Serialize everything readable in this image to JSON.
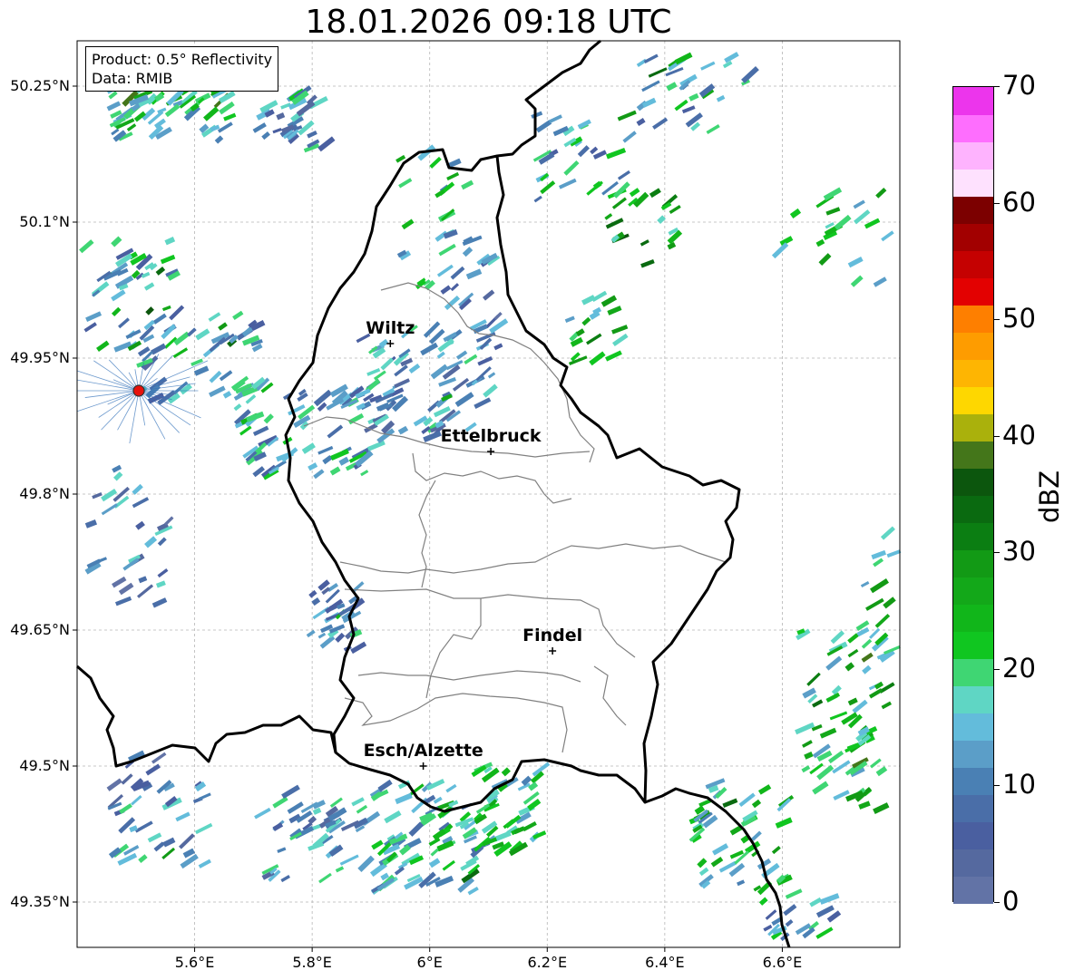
{
  "title": "18.01.2026 09:18 UTC",
  "info": {
    "product": "Product: 0.5° Reflectivity",
    "data": "Data: RMIB"
  },
  "map": {
    "lon_range": [
      5.4,
      6.8
    ],
    "lat_range": [
      49.3,
      50.3
    ],
    "lat_ticks": [
      {
        "value": 50.25,
        "label": "50.25°N"
      },
      {
        "value": 50.1,
        "label": "50.1°N"
      },
      {
        "value": 49.95,
        "label": "49.95°N"
      },
      {
        "value": 49.8,
        "label": "49.8°N"
      },
      {
        "value": 49.65,
        "label": "49.65°N"
      },
      {
        "value": 49.5,
        "label": "49.5°N"
      },
      {
        "value": 49.35,
        "label": "49.35°N"
      }
    ],
    "lon_ticks": [
      {
        "value": 5.6,
        "label": "5.6°E"
      },
      {
        "value": 5.8,
        "label": "5.8°E"
      },
      {
        "value": 6.0,
        "label": "6°E"
      },
      {
        "value": 6.2,
        "label": "6.2°E"
      },
      {
        "value": 6.4,
        "label": "6.4°E"
      },
      {
        "value": 6.6,
        "label": "6.6°E"
      }
    ],
    "grid": true,
    "radar_site": {
      "lon": 5.505,
      "lat": 49.914,
      "color": "#e8120c"
    },
    "cities": [
      {
        "name": "Wiltz",
        "lon": 5.933,
        "lat": 49.966
      },
      {
        "name": "Ettelbruck",
        "lon": 6.104,
        "lat": 49.847
      },
      {
        "name": "Findel",
        "lon": 6.209,
        "lat": 49.627
      },
      {
        "name": "Esch/Alzette",
        "lon": 5.989,
        "lat": 49.5
      }
    ],
    "echo_clusters": [
      {
        "lon": 5.55,
        "lat": 50.22,
        "rx": 0.1,
        "ry": 0.03,
        "n": 60,
        "level": 18
      },
      {
        "lon": 5.75,
        "lat": 50.21,
        "rx": 0.06,
        "ry": 0.03,
        "n": 30,
        "level": 12
      },
      {
        "lon": 5.48,
        "lat": 50.02,
        "rx": 0.08,
        "ry": 0.06,
        "n": 45,
        "level": 15
      },
      {
        "lon": 5.6,
        "lat": 49.95,
        "rx": 0.1,
        "ry": 0.05,
        "n": 50,
        "level": 12
      },
      {
        "lon": 5.78,
        "lat": 49.87,
        "rx": 0.12,
        "ry": 0.05,
        "n": 70,
        "level": 14
      },
      {
        "lon": 5.95,
        "lat": 49.92,
        "rx": 0.08,
        "ry": 0.06,
        "n": 60,
        "level": 12
      },
      {
        "lon": 6.06,
        "lat": 49.97,
        "rx": 0.05,
        "ry": 0.1,
        "n": 40,
        "level": 10
      },
      {
        "lon": 6.0,
        "lat": 50.1,
        "rx": 0.06,
        "ry": 0.08,
        "n": 25,
        "level": 18
      },
      {
        "lon": 6.25,
        "lat": 50.17,
        "rx": 0.08,
        "ry": 0.05,
        "n": 30,
        "level": 15
      },
      {
        "lon": 6.35,
        "lat": 50.09,
        "rx": 0.06,
        "ry": 0.05,
        "n": 20,
        "level": 25
      },
      {
        "lon": 6.28,
        "lat": 49.98,
        "rx": 0.05,
        "ry": 0.04,
        "n": 18,
        "level": 22
      },
      {
        "lon": 6.45,
        "lat": 50.24,
        "rx": 0.1,
        "ry": 0.04,
        "n": 30,
        "level": 14
      },
      {
        "lon": 6.68,
        "lat": 50.08,
        "rx": 0.1,
        "ry": 0.05,
        "n": 20,
        "level": 22
      },
      {
        "lon": 5.48,
        "lat": 49.75,
        "rx": 0.07,
        "ry": 0.08,
        "n": 30,
        "level": 10
      },
      {
        "lon": 5.83,
        "lat": 49.66,
        "rx": 0.04,
        "ry": 0.04,
        "n": 30,
        "level": 10
      },
      {
        "lon": 5.53,
        "lat": 49.45,
        "rx": 0.08,
        "ry": 0.06,
        "n": 40,
        "level": 10
      },
      {
        "lon": 5.8,
        "lat": 49.42,
        "rx": 0.1,
        "ry": 0.05,
        "n": 50,
        "level": 12
      },
      {
        "lon": 6.0,
        "lat": 49.42,
        "rx": 0.1,
        "ry": 0.06,
        "n": 80,
        "level": 16
      },
      {
        "lon": 6.12,
        "lat": 49.45,
        "rx": 0.06,
        "ry": 0.05,
        "n": 40,
        "level": 20
      },
      {
        "lon": 6.52,
        "lat": 49.42,
        "rx": 0.08,
        "ry": 0.06,
        "n": 50,
        "level": 20
      },
      {
        "lon": 6.7,
        "lat": 49.55,
        "rx": 0.08,
        "ry": 0.1,
        "n": 70,
        "level": 22
      },
      {
        "lon": 6.62,
        "lat": 49.33,
        "rx": 0.06,
        "ry": 0.03,
        "n": 20,
        "level": 14
      },
      {
        "lon": 6.76,
        "lat": 49.68,
        "rx": 0.04,
        "ry": 0.08,
        "n": 20,
        "level": 22
      }
    ]
  },
  "colorbar": {
    "label": "dBZ",
    "min": 0,
    "max": 70,
    "ticks": [
      {
        "value": 0,
        "label": "0"
      },
      {
        "value": 10,
        "label": "10"
      },
      {
        "value": 20,
        "label": "20"
      },
      {
        "value": 30,
        "label": "30"
      },
      {
        "value": 40,
        "label": "40"
      },
      {
        "value": 50,
        "label": "50"
      },
      {
        "value": 60,
        "label": "60"
      },
      {
        "value": 70,
        "label": "70"
      }
    ],
    "colors": [
      "#6273a6",
      "#55699f",
      "#4a5fa0",
      "#4a6ea8",
      "#4a80b4",
      "#5b9ec8",
      "#63bcdb",
      "#5fd6c4",
      "#3fd673",
      "#10c620",
      "#11b61a",
      "#13a819",
      "#129a15",
      "#0b7e12",
      "#0a6a10",
      "#0c560d",
      "#44761a",
      "#aab10c",
      "#fed700",
      "#feb502",
      "#fe9c00",
      "#fe7f00",
      "#e30101",
      "#c50101",
      "#a20000",
      "#7c0000",
      "#fee1fe",
      "#feb3fe",
      "#fe6efe",
      "#ec35ec"
    ]
  }
}
